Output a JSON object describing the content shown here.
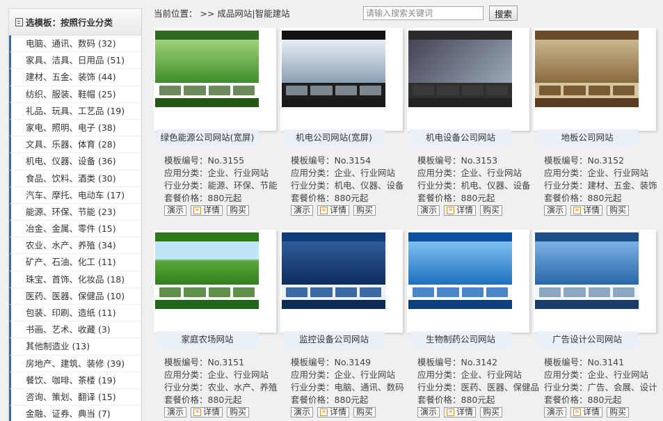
{
  "sidebar": {
    "title": "选模板：按照行业分类",
    "items": [
      "电脑、通讯、数码 (32)",
      "家具、洁具、日用品 (51)",
      "建材、五金、装饰 (44)",
      "纺织、服装、鞋帽 (25)",
      "礼品、玩具、工艺品 (19)",
      "家电、照明、电子 (38)",
      "文具、乐器、体育 (28)",
      "机电、仪器、设备 (36)",
      "食品、饮料、酒类 (30)",
      "汽车、摩托、电动车 (17)",
      "能源、环保、节能 (23)",
      "冶金、金属、零件 (15)",
      "农业、水产、养殖 (34)",
      "矿产、石油、化工 (11)",
      "珠宝、首饰、化妆品 (18)",
      "医药、医器、保健品 (10)",
      "包装、印刷、造纸 (11)",
      "书画、艺术、收藏 (3)",
      "其他制造业 (13)",
      "房地产、建筑、装修 (39)",
      "餐饮、咖啡、茶楼 (19)",
      "咨询、策划、翻译 (15)",
      "金融、证券、典当 (7)"
    ]
  },
  "breadcrumb": "当前位置： >> 成品网站|智能建站",
  "search": {
    "placeholder": "请输入搜索关键词",
    "button": "搜索"
  },
  "buttons": {
    "demo": "演示",
    "detail": "详情",
    "buy": "购买"
  },
  "cards": [
    {
      "caption": "绿色能源公司网站(宽屏)",
      "code": "模板编号：No.3155",
      "app": "应用分类：企业、行业网站",
      "ind": "行业分类：能源、环保、节能",
      "price": "套餐价格：880元起",
      "theme": "green"
    },
    {
      "caption": "机电公司网站(宽屏)",
      "code": "模板编号：No.3154",
      "app": "应用分类：企业、行业网站",
      "ind": "行业分类：机电、仪器、设备",
      "price": "套餐价格：880元起",
      "theme": "dark"
    },
    {
      "caption": "机电设备公司网站",
      "code": "模板编号：No.3153",
      "app": "应用分类：企业、行业网站",
      "ind": "行业分类：机电、仪器、设备",
      "price": "套餐价格：880元起",
      "theme": "mech"
    },
    {
      "caption": "地板公司网站",
      "code": "模板编号：No.3152",
      "app": "应用分类：企业、行业网站",
      "ind": "行业分类：建材、五金、装饰",
      "price": "套餐价格：880元起",
      "theme": "wood"
    },
    {
      "caption": "家庭农场网站",
      "code": "模板编号：No.3151",
      "app": "应用分类：企业、行业网站",
      "ind": "行业分类：农业、水产、养殖",
      "price": "套餐价格：880元起",
      "theme": "farm"
    },
    {
      "caption": "监控设备公司网站",
      "code": "模板编号：No.3149",
      "app": "应用分类：企业、行业网站",
      "ind": "行业分类：电脑、通讯、数码",
      "price": "套餐价格：880元起",
      "theme": "blue"
    },
    {
      "caption": "生物制药公司网站",
      "code": "模板编号：No.3142",
      "app": "应用分类：企业、行业网站",
      "ind": "行业分类：医药、医器、保健品",
      "price": "套餐价格：880元起",
      "theme": "sky"
    },
    {
      "caption": "广告设计公司网站",
      "code": "模板编号：No.3141",
      "app": "应用分类：企业、行业网站",
      "ind": "行业分类：广告、会展、设计",
      "price": "套餐价格：880元起",
      "theme": "design"
    }
  ],
  "colors": {
    "accent": "#2f6ea5",
    "caption_bg": "#e9f0f7",
    "arrow": "#e08a2a"
  }
}
